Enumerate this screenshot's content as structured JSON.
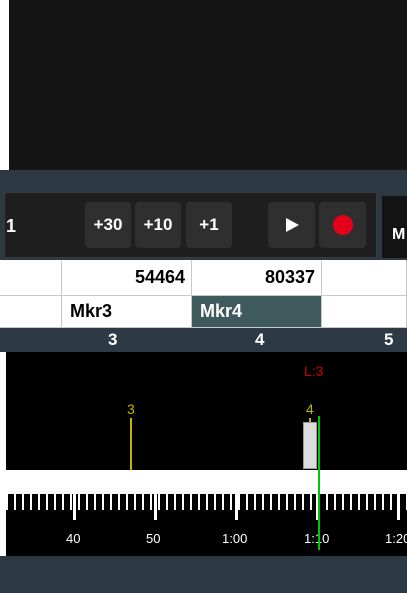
{
  "toolbar": {
    "cut_label": "1",
    "buttons": [
      "+30",
      "+10",
      "+1"
    ],
    "right_label": "M"
  },
  "markers_table": {
    "positions": [
      "54464",
      "80337"
    ],
    "names": [
      "Mkr3",
      "Mkr4"
    ]
  },
  "beat_ruler": [
    "3",
    "4",
    "5"
  ],
  "marker_lane": {
    "loop_label": "L:3",
    "markers": [
      "3",
      "4"
    ]
  },
  "time_ruler": [
    "40",
    "50",
    "1:00",
    "1:10",
    "1:20"
  ],
  "colors": {
    "toolbar_bg": "#2c3944",
    "record": "#e3001b",
    "marker": "#c4b300",
    "playhead": "#00c800",
    "loop": "#d10000",
    "selected_cell": "#3f5a5c"
  }
}
